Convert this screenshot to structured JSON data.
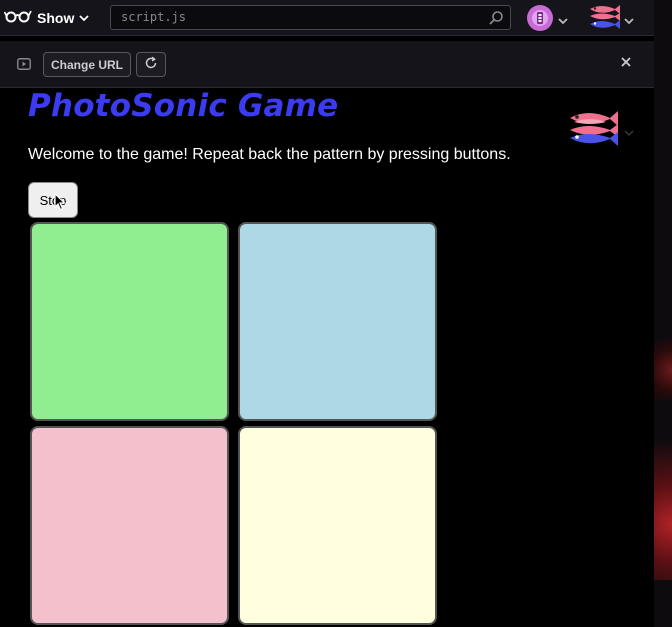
{
  "toolbar": {
    "show_label": "Show",
    "search_value": "script.js",
    "change_url_label": "Change URL"
  },
  "page": {
    "title": "PhotoSonic Game",
    "welcome": "Welcome to the game! Repeat back the pattern by pressing buttons.",
    "stop_label": "Stop"
  },
  "pads": [
    {
      "name": "green",
      "color": "#90ee90"
    },
    {
      "name": "blue",
      "color": "#add8e6"
    },
    {
      "name": "pink",
      "color": "#f4c0cb"
    },
    {
      "name": "yellow",
      "color": "#ffffe0"
    }
  ],
  "colors": {
    "title": "#3b3bf2",
    "toolbar_bg": "#16141b",
    "page_bg": "#000000"
  }
}
